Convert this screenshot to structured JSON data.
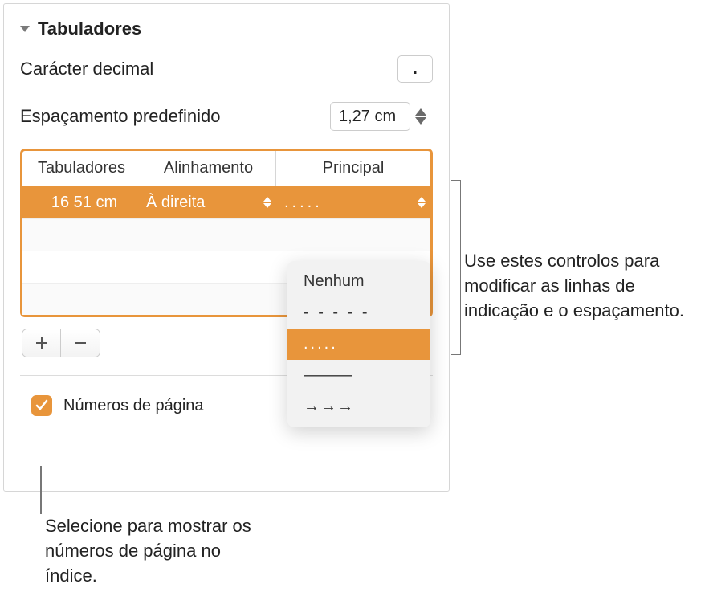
{
  "section_title": "Tabuladores",
  "decimal": {
    "label": "Carácter decimal",
    "value": "."
  },
  "spacing": {
    "label": "Espaçamento predefinido",
    "value": "1,27 cm"
  },
  "table": {
    "headers": {
      "stops": "Tabuladores",
      "alignment": "Alinhamento",
      "leader": "Principal"
    },
    "row": {
      "stop": "16 51 cm",
      "alignment": "À direita",
      "leader": "....."
    }
  },
  "dropdown": {
    "none": "Nenhum",
    "dashes": "- - - - -",
    "dots": ".....",
    "line": "———",
    "arrows": "→→→"
  },
  "page_numbers_label": "Números de página",
  "callout_right": "Use estes controlos para modificar as linhas de indicação e o espaçamento.",
  "callout_bottom": "Selecione para mostrar os números de página no índice."
}
